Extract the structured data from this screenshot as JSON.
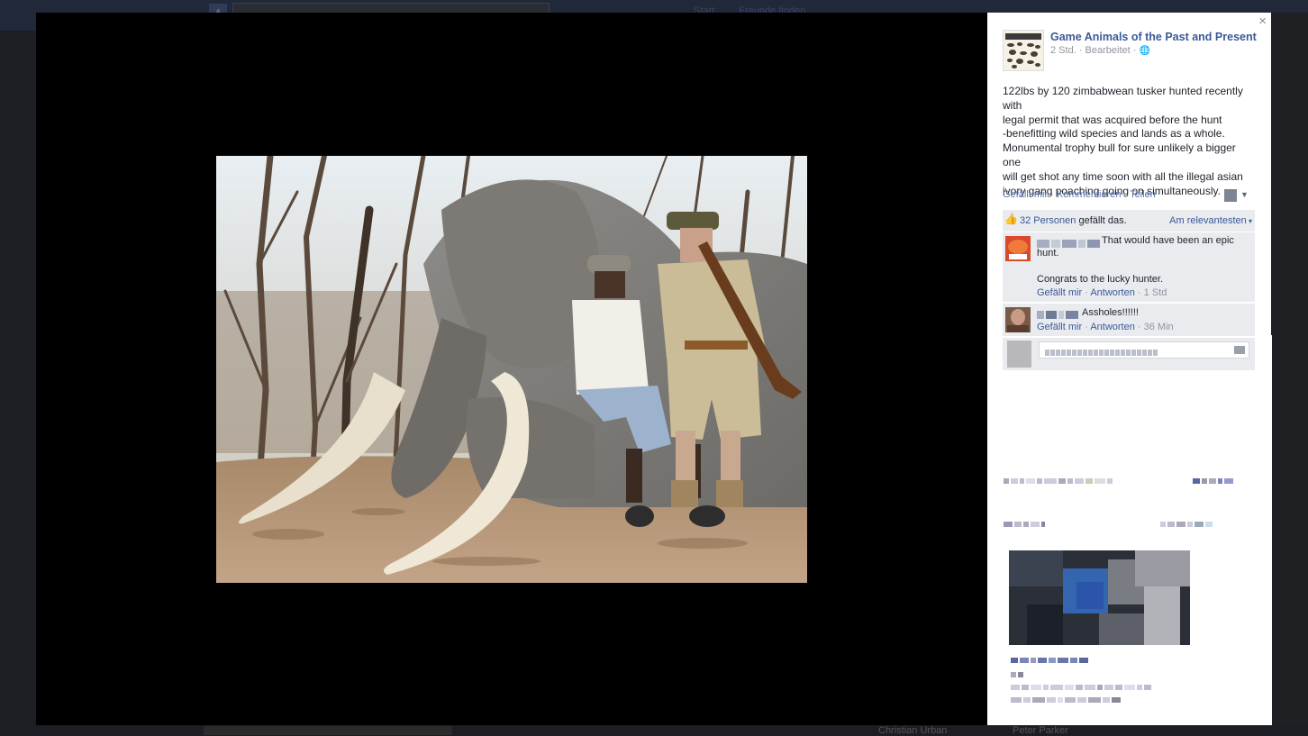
{
  "background": {
    "nav_items": [
      "Start",
      "Freunde finden"
    ],
    "footer_names": [
      "Christian Urban",
      "Peter Parker"
    ]
  },
  "viewer": {
    "close_glyph": "×"
  },
  "post": {
    "page_name": "Game Animals of the Past and Present",
    "time": "2 Std.",
    "edited": "Bearbeitet",
    "privacy_icon": "globe-icon",
    "text_lines": [
      "122lbs by 120 zimbabwean tusker hunted recently with",
      "legal permit that was acquired before the hunt",
      "-benefitting wild species and lands as a whole.",
      "Monumental trophy bull for sure unlikely a bigger one",
      "will get shot any time soon with all the illegal asian",
      "ivory gang poaching going on simultaneously."
    ],
    "actions": {
      "like": "Gefällt mir",
      "comment": "Kommentieren",
      "share": "Teilen"
    },
    "likes": {
      "count": "32 Personen",
      "suffix": "gefällt das.",
      "sort": "Am relevantesten"
    }
  },
  "comments": [
    {
      "text1": "That would have been an epic hunt.",
      "text2": "Congrats to the lucky hunter.",
      "like": "Gefällt mir",
      "reply": "Antworten",
      "time": "1 Std"
    },
    {
      "text1": "Assholes!!!!!!",
      "like": "Gefällt mir",
      "reply": "Antworten",
      "time": "36 Min"
    }
  ],
  "colors": {
    "link": "#3b5998",
    "panel_bg": "#ffffff",
    "comment_bg": "#e9ebee",
    "stage_bg": "#000000"
  }
}
